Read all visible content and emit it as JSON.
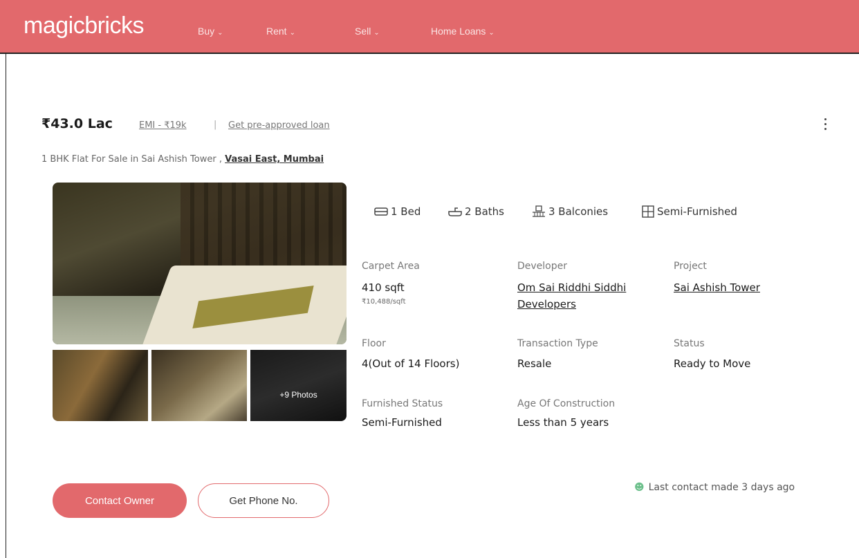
{
  "header": {
    "logo": "magicbricks",
    "nav": [
      {
        "label": "Buy"
      },
      {
        "label": "Rent"
      },
      {
        "label": "Sell"
      },
      {
        "label": "Home Loans"
      }
    ]
  },
  "listing": {
    "price": "₹43.0 Lac",
    "emi": "EMI - ₹19k",
    "separator": "|",
    "preapproved": "Get pre-approved loan",
    "title_prefix": "1 BHK Flat For Sale in Sai Ashish Tower ,",
    "locality": "Vasai East, Mumbai",
    "photos_more": "+9 Photos",
    "amenities": {
      "bed": "1 Bed",
      "baths": "2 Baths",
      "balconies": "3 Balconies",
      "furnishing": "Semi-Furnished"
    },
    "details": {
      "carpet_label": "Carpet Area",
      "carpet_value": "410 sqft",
      "carpet_rate": "₹10,488/sqft",
      "developer_label": "Developer",
      "developer_line1": "Om Sai Riddhi Siddhi",
      "developer_line2": "Developers",
      "project_label": "Project",
      "project_value": "Sai Ashish Tower",
      "floor_label": "Floor",
      "floor_value": "4(Out of 14 Floors)",
      "transaction_label": "Transaction Type",
      "transaction_value": "Resale",
      "status_label": "Status",
      "status_value": "Ready to Move",
      "furnished_label": "Furnished Status",
      "furnished_value": "Semi-Furnished",
      "age_label": "Age Of Construction",
      "age_value": "Less than 5 years"
    },
    "actions": {
      "contact_owner": "Contact Owner",
      "get_phone": "Get Phone No.",
      "last_contact": "Last contact made 3 days ago"
    }
  },
  "colors": {
    "brand": "#e2696c",
    "accent_green": "#6bbf8a"
  }
}
